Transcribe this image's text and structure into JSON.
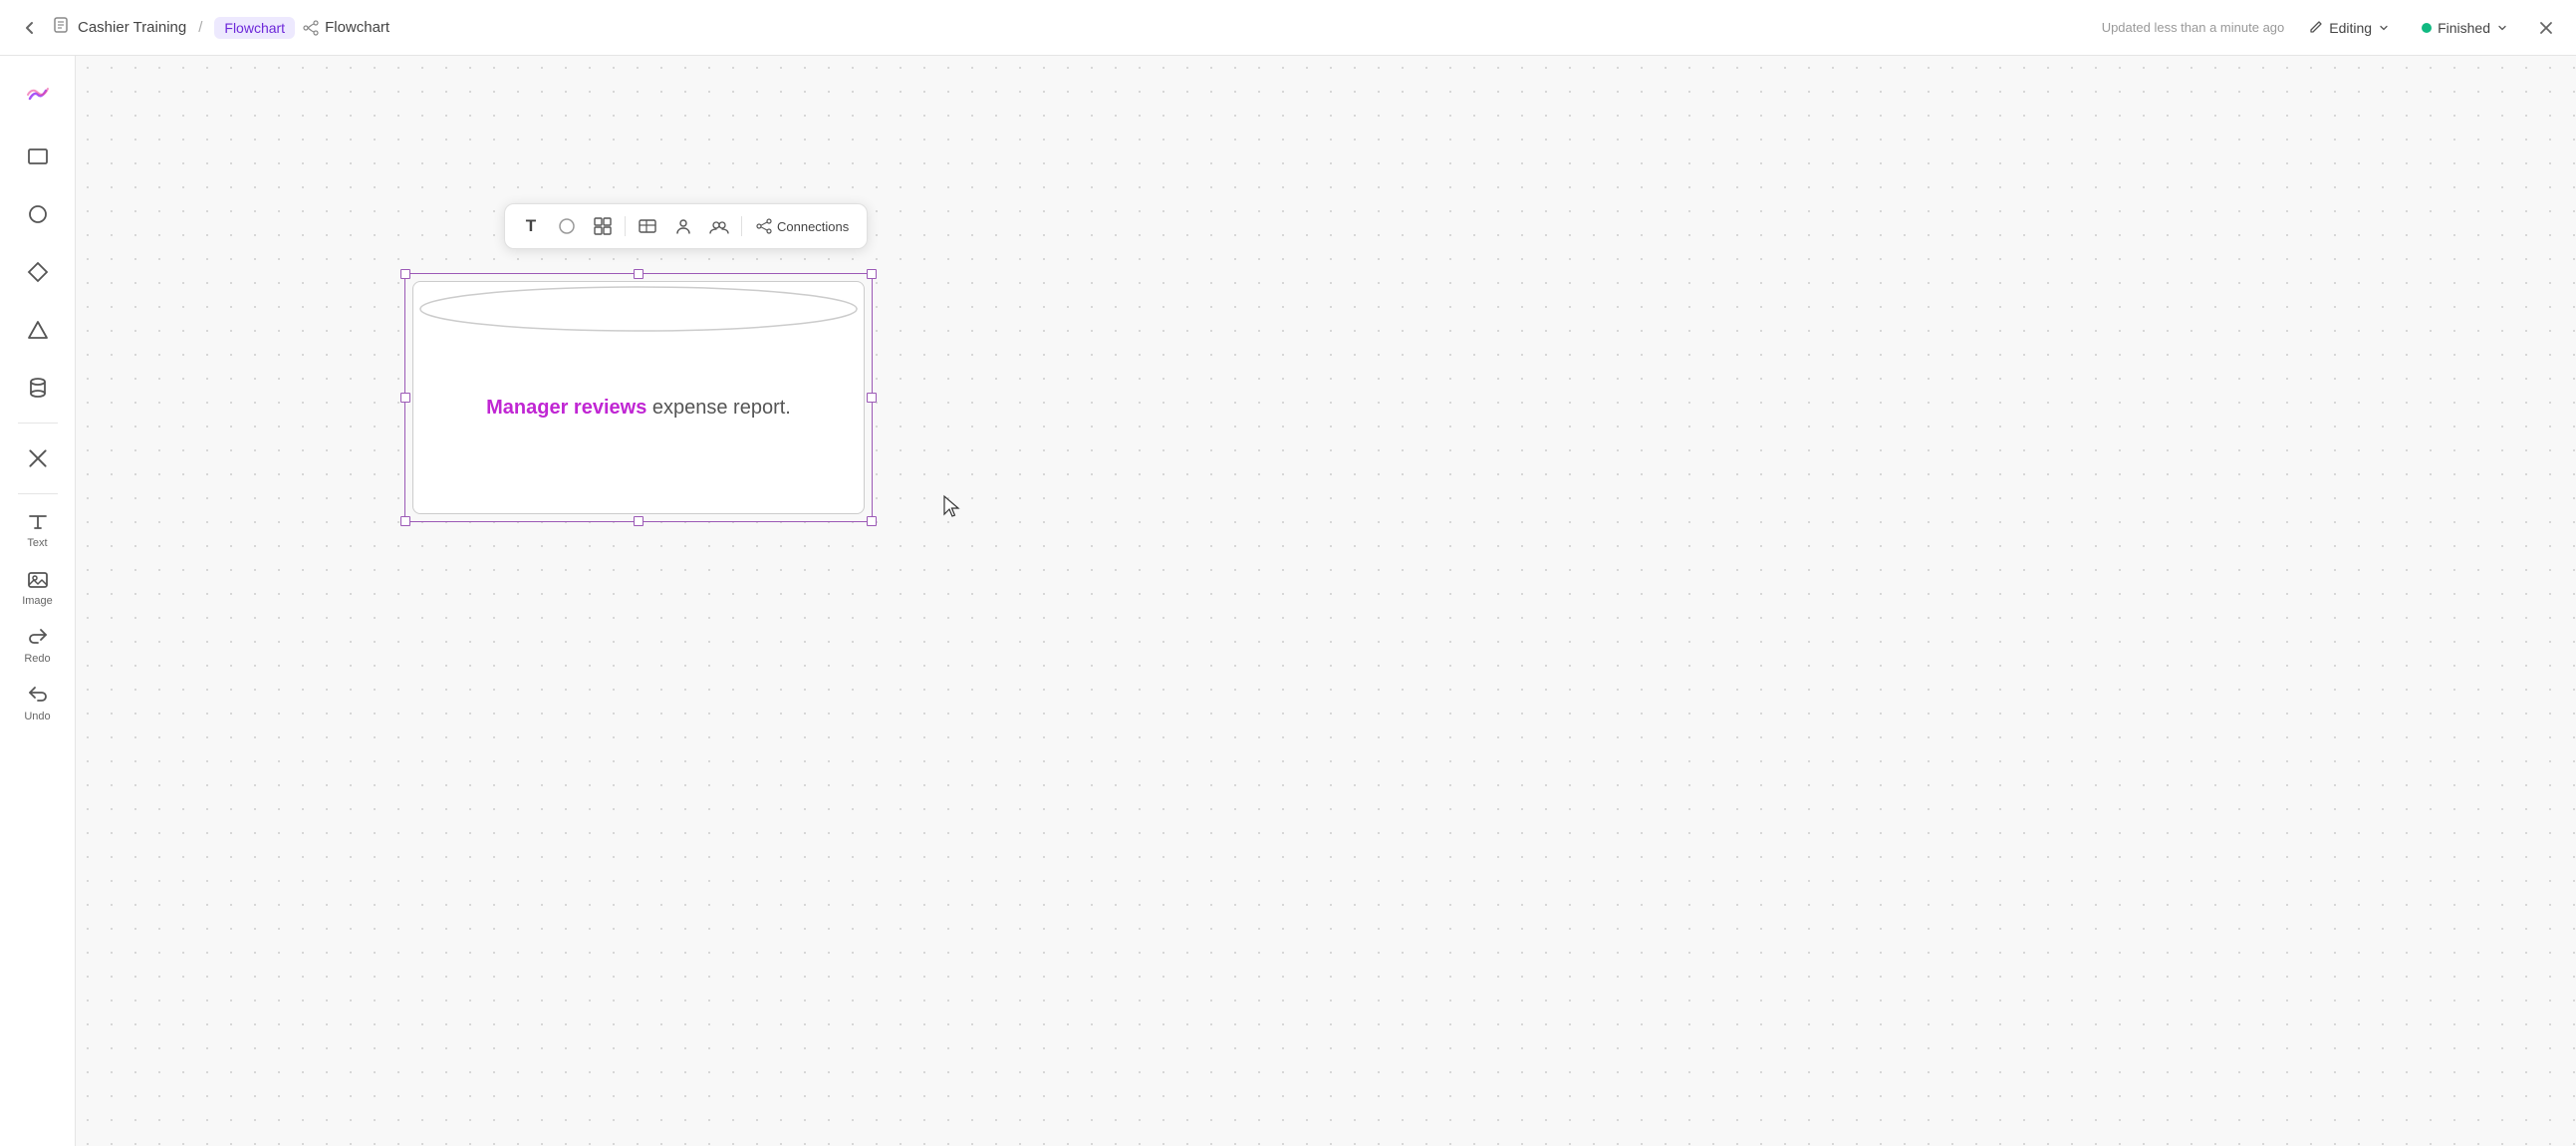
{
  "header": {
    "back_label": "←",
    "breadcrumb_icon": "📋",
    "title": "Cashier Training",
    "separator": "/",
    "active_tab": "Flowchart",
    "flowchart_label": "Flowchart",
    "updated_text": "Updated less than a minute ago",
    "editing_label": "Editing",
    "finished_label": "Finished",
    "close_label": "×"
  },
  "sidebar": {
    "logo_label": "logo",
    "items": [
      {
        "id": "rectangle",
        "label": "",
        "icon": "rect"
      },
      {
        "id": "circle",
        "label": "",
        "icon": "circle"
      },
      {
        "id": "diamond",
        "label": "",
        "icon": "diamond"
      },
      {
        "id": "triangle",
        "label": "",
        "icon": "triangle"
      },
      {
        "id": "cylinder",
        "label": "",
        "icon": "cylinder"
      },
      {
        "id": "close",
        "label": "",
        "icon": "x"
      },
      {
        "id": "text",
        "label": "Text",
        "icon": "text"
      },
      {
        "id": "image",
        "label": "Image",
        "icon": "image"
      },
      {
        "id": "redo",
        "label": "Redo",
        "icon": "redo"
      },
      {
        "id": "undo",
        "label": "Undo",
        "icon": "undo"
      }
    ]
  },
  "toolbar": {
    "text_btn": "T",
    "circle_btn": "○",
    "layout_btn": "layout",
    "table_btn": "table",
    "person_btn": "person",
    "group_btn": "group",
    "connections_label": "Connections"
  },
  "canvas": {
    "shape": {
      "text_highlighted": "Manager reviews",
      "text_normal": " expense report."
    }
  }
}
